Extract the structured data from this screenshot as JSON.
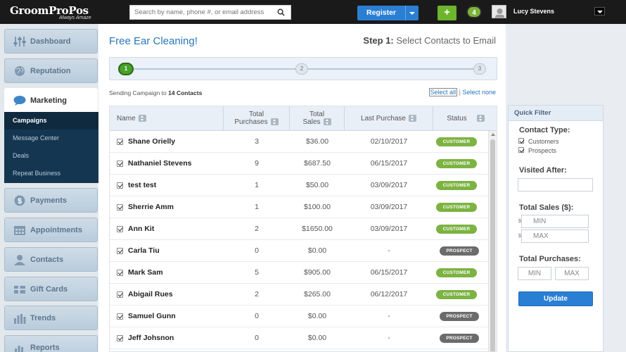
{
  "header": {
    "logo": "GroomProPos",
    "logo_tagline": "Always Amaze",
    "search_placeholder": "Search by name, phone #, or email address",
    "register_label": "Register",
    "add_label": "+",
    "notification_count": "4",
    "user_name": "Lucy Stevens"
  },
  "sidebar": {
    "items": [
      {
        "label": "Dashboard",
        "icon": "sliders-icon"
      },
      {
        "label": "Reputation",
        "icon": "globe-icon"
      },
      {
        "label": "Marketing",
        "icon": "chat-bubble-icon"
      },
      {
        "label": "Payments",
        "icon": "dollar-icon"
      },
      {
        "label": "Appointments",
        "icon": "calendar-icon"
      },
      {
        "label": "Contacts",
        "icon": "person-icon"
      },
      {
        "label": "Gift Cards",
        "icon": "gift-card-icon"
      },
      {
        "label": "Trends",
        "icon": "bar-chart-icon"
      },
      {
        "label": "Reports",
        "icon": "report-chart-icon"
      }
    ],
    "submenu": [
      "Campaigns",
      "Message Center",
      "Deals",
      "Repeat Business"
    ]
  },
  "main": {
    "campaign_title": "Free Ear Cleaning!",
    "step_prefix": "Step 1:",
    "step_text": "Select Contacts to Email",
    "steps": [
      "1",
      "2",
      "3"
    ],
    "sending_prefix": "Sending Campaign to",
    "sending_count": "14 Contacts",
    "select_all": "Select all",
    "separator": "|",
    "select_none": "Select none",
    "columns": {
      "name": "Name",
      "purchases_1": "Total",
      "purchases_2": "Purchases",
      "sales_1": "Total",
      "sales_2": "Sales",
      "last_purchase": "Last Purchase",
      "status": "Status"
    },
    "rows": [
      {
        "name": "Shane Orielly",
        "purchases": "3",
        "sales": "$36.00",
        "last": "02/10/2017",
        "status": "CUSTOMER"
      },
      {
        "name": "Nathaniel Stevens",
        "purchases": "9",
        "sales": "$687.50",
        "last": "06/15/2017",
        "status": "CUSTOMER"
      },
      {
        "name": "test test",
        "purchases": "1",
        "sales": "$50.00",
        "last": "03/09/2017",
        "status": "CUSTOMER"
      },
      {
        "name": "Sherrie Amm",
        "purchases": "1",
        "sales": "$100.00",
        "last": "03/09/2017",
        "status": "CUSTOMER"
      },
      {
        "name": "Ann Kit",
        "purchases": "2",
        "sales": "$1650.00",
        "last": "03/09/2017",
        "status": "CUSTOMER"
      },
      {
        "name": "Carla Tiu",
        "purchases": "0",
        "sales": "$0.00",
        "last": "-",
        "status": "PROSPECT"
      },
      {
        "name": "Mark Sam",
        "purchases": "5",
        "sales": "$905.00",
        "last": "06/15/2017",
        "status": "CUSTOMER"
      },
      {
        "name": "Abigail Rues",
        "purchases": "2",
        "sales": "$265.00",
        "last": "06/12/2017",
        "status": "CUSTOMER"
      },
      {
        "name": "Samuel Gunn",
        "purchases": "0",
        "sales": "$0.00",
        "last": "-",
        "status": "PROSPECT"
      },
      {
        "name": "Jeff Johsnon",
        "purchases": "0",
        "sales": "$0.00",
        "last": "-",
        "status": "PROSPECT"
      }
    ]
  },
  "quick_filter": {
    "title": "Quick Filter",
    "contact_type_label": "Contact Type:",
    "customers_label": "Customers",
    "prospects_label": "Prospects",
    "visited_after_label": "Visited After:",
    "total_sales_label": "Total Sales ($):",
    "currency_symbol": "$",
    "min_placeholder": "MIN",
    "max_placeholder": "MAX",
    "total_purchases_label": "Total Purchases:",
    "update_label": "Update"
  },
  "colors": {
    "primary_blue": "#2a7fd4",
    "customer_green": "#7cb342",
    "prospect_gray": "#6b6b6b",
    "sidebar_dark": "#153650"
  }
}
